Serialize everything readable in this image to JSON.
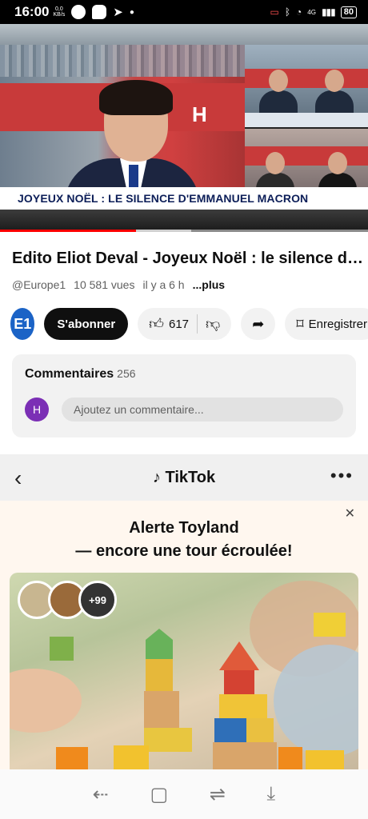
{
  "status_bar": {
    "time": "16:00",
    "net_speed_value": "0,0",
    "net_speed_unit": "KB/s",
    "battery": "80",
    "signal_label": "4G"
  },
  "video": {
    "banner_text": "JOYEUX NOËL : LE SILENCE D'EMMANUEL MACRON",
    "logo_letter": "H",
    "progress_fraction": 0.37,
    "buffer_fraction": 0.52
  },
  "details": {
    "title": "Edito Eliot Deval - Joyeux Noël : le silence d'Emmanuel Macron",
    "channel_handle": "@Europe1",
    "views": "10 581 vues",
    "age": "il y a 6 h",
    "more": "...plus"
  },
  "actions": {
    "channel_logo": "E1",
    "subscribe": "S'abonner",
    "likes": "617",
    "save": "Enregistrer"
  },
  "comments": {
    "heading": "Commentaires",
    "count": "256",
    "avatar_letter": "H",
    "placeholder": "Ajoutez un commentaire..."
  },
  "ad": {
    "brand": "TikTok",
    "title_line1": "Alerte Toyland",
    "title_line2": "— encore une tour écroulée!",
    "avatar_more": "+99"
  },
  "icons": {
    "back": "chevron-left-icon",
    "more": "more-dots-icon",
    "close": "close-icon",
    "like": "thumbs-up-icon",
    "dislike": "thumbs-down-icon",
    "share": "share-icon",
    "save": "bookmark-icon"
  },
  "colors": {
    "accent_red": "#ff0000",
    "subscribe_bg": "#0f0f0f",
    "channel_blue": "#1b63c6",
    "avatar_purple": "#7b2fb5"
  }
}
